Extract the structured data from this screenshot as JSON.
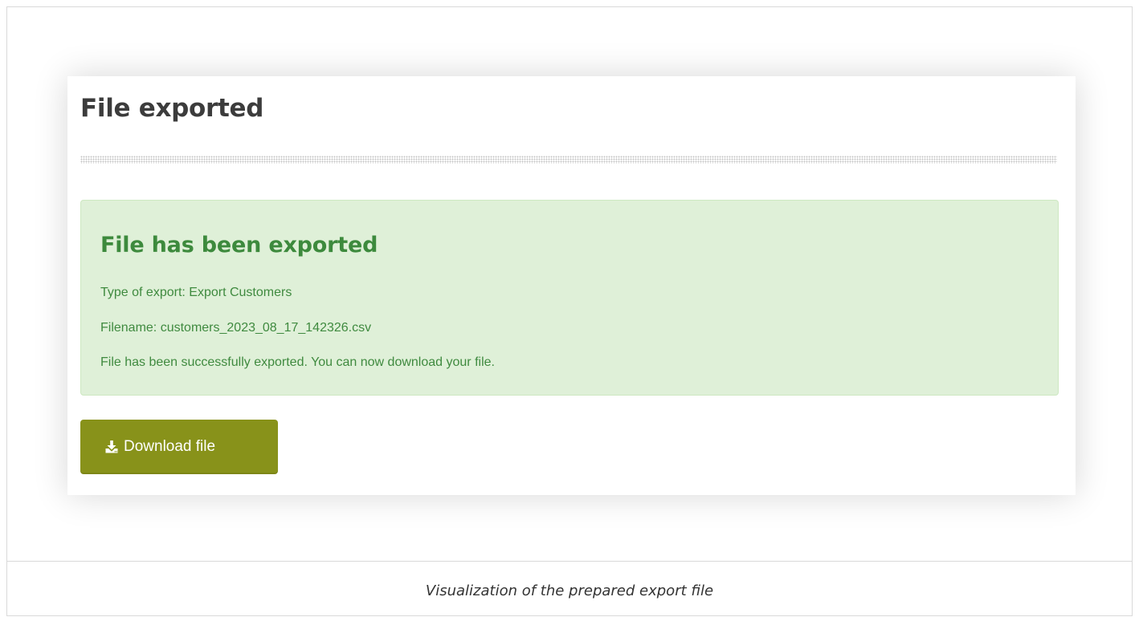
{
  "panel": {
    "title": "File exported"
  },
  "alert": {
    "heading": "File has been exported",
    "type_line": "Type of export: Export Customers",
    "filename_line": "Filename: customers_2023_08_17_142326.csv",
    "message_line": "File has been successfully exported. You can now download your file.",
    "bg_color": "#dff0d8",
    "text_color": "#3d8a3d"
  },
  "actions": {
    "download_label": "Download file",
    "download_icon": "download-icon",
    "button_color": "#88921a"
  },
  "caption": {
    "text": "Visualization of the prepared export file"
  }
}
